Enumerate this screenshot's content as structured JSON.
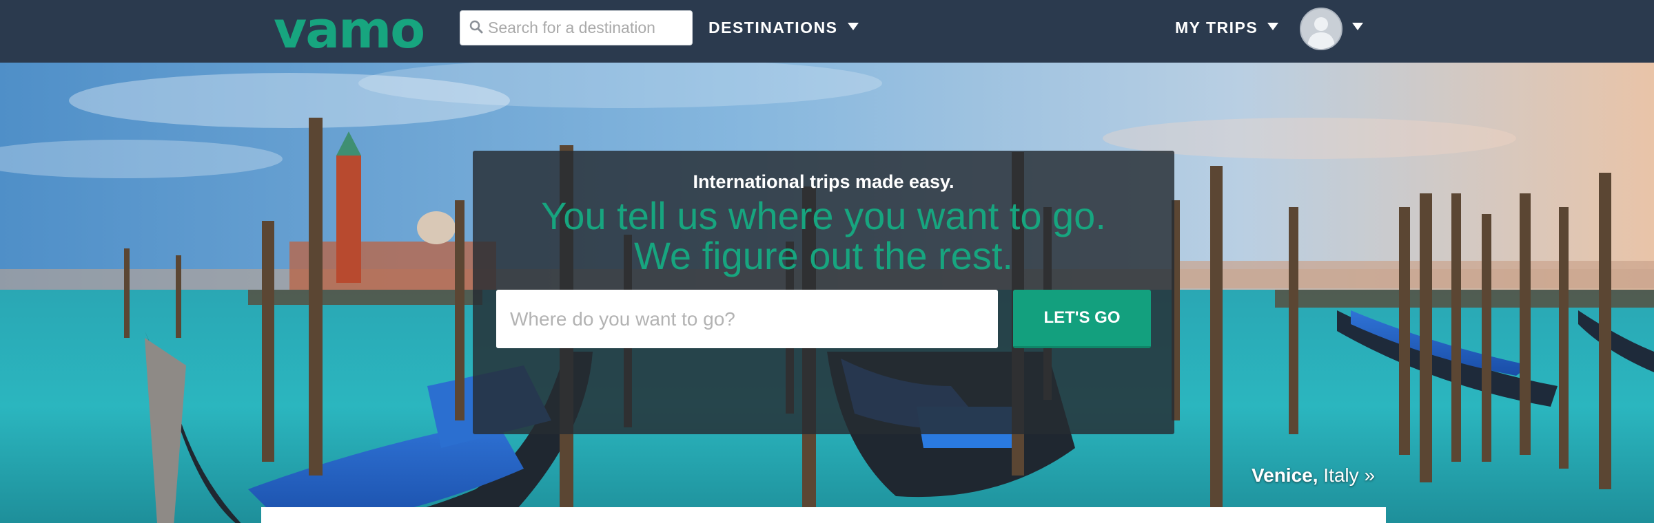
{
  "brand": {
    "logo_text": "vamo",
    "accent_color": "#17a57f",
    "nav_bg_color": "#2b3a4e"
  },
  "navbar": {
    "search": {
      "placeholder": "Search for a destination",
      "value": "",
      "icon": "search-icon"
    },
    "destinations_label": "DESTINATIONS",
    "my_trips_label": "MY TRIPS",
    "avatar_icon": "user-avatar-icon"
  },
  "hero": {
    "background": "Venice gondolas photo",
    "tagline": "International trips made easy.",
    "headline_line1": "You tell us where you want to go.",
    "headline_line2": "We figure out the rest.",
    "input": {
      "placeholder": "Where do you want to go?",
      "value": ""
    },
    "button_label": "LET'S GO",
    "location": {
      "city": "Venice,",
      "country": "Italy",
      "arrow": "»"
    }
  }
}
